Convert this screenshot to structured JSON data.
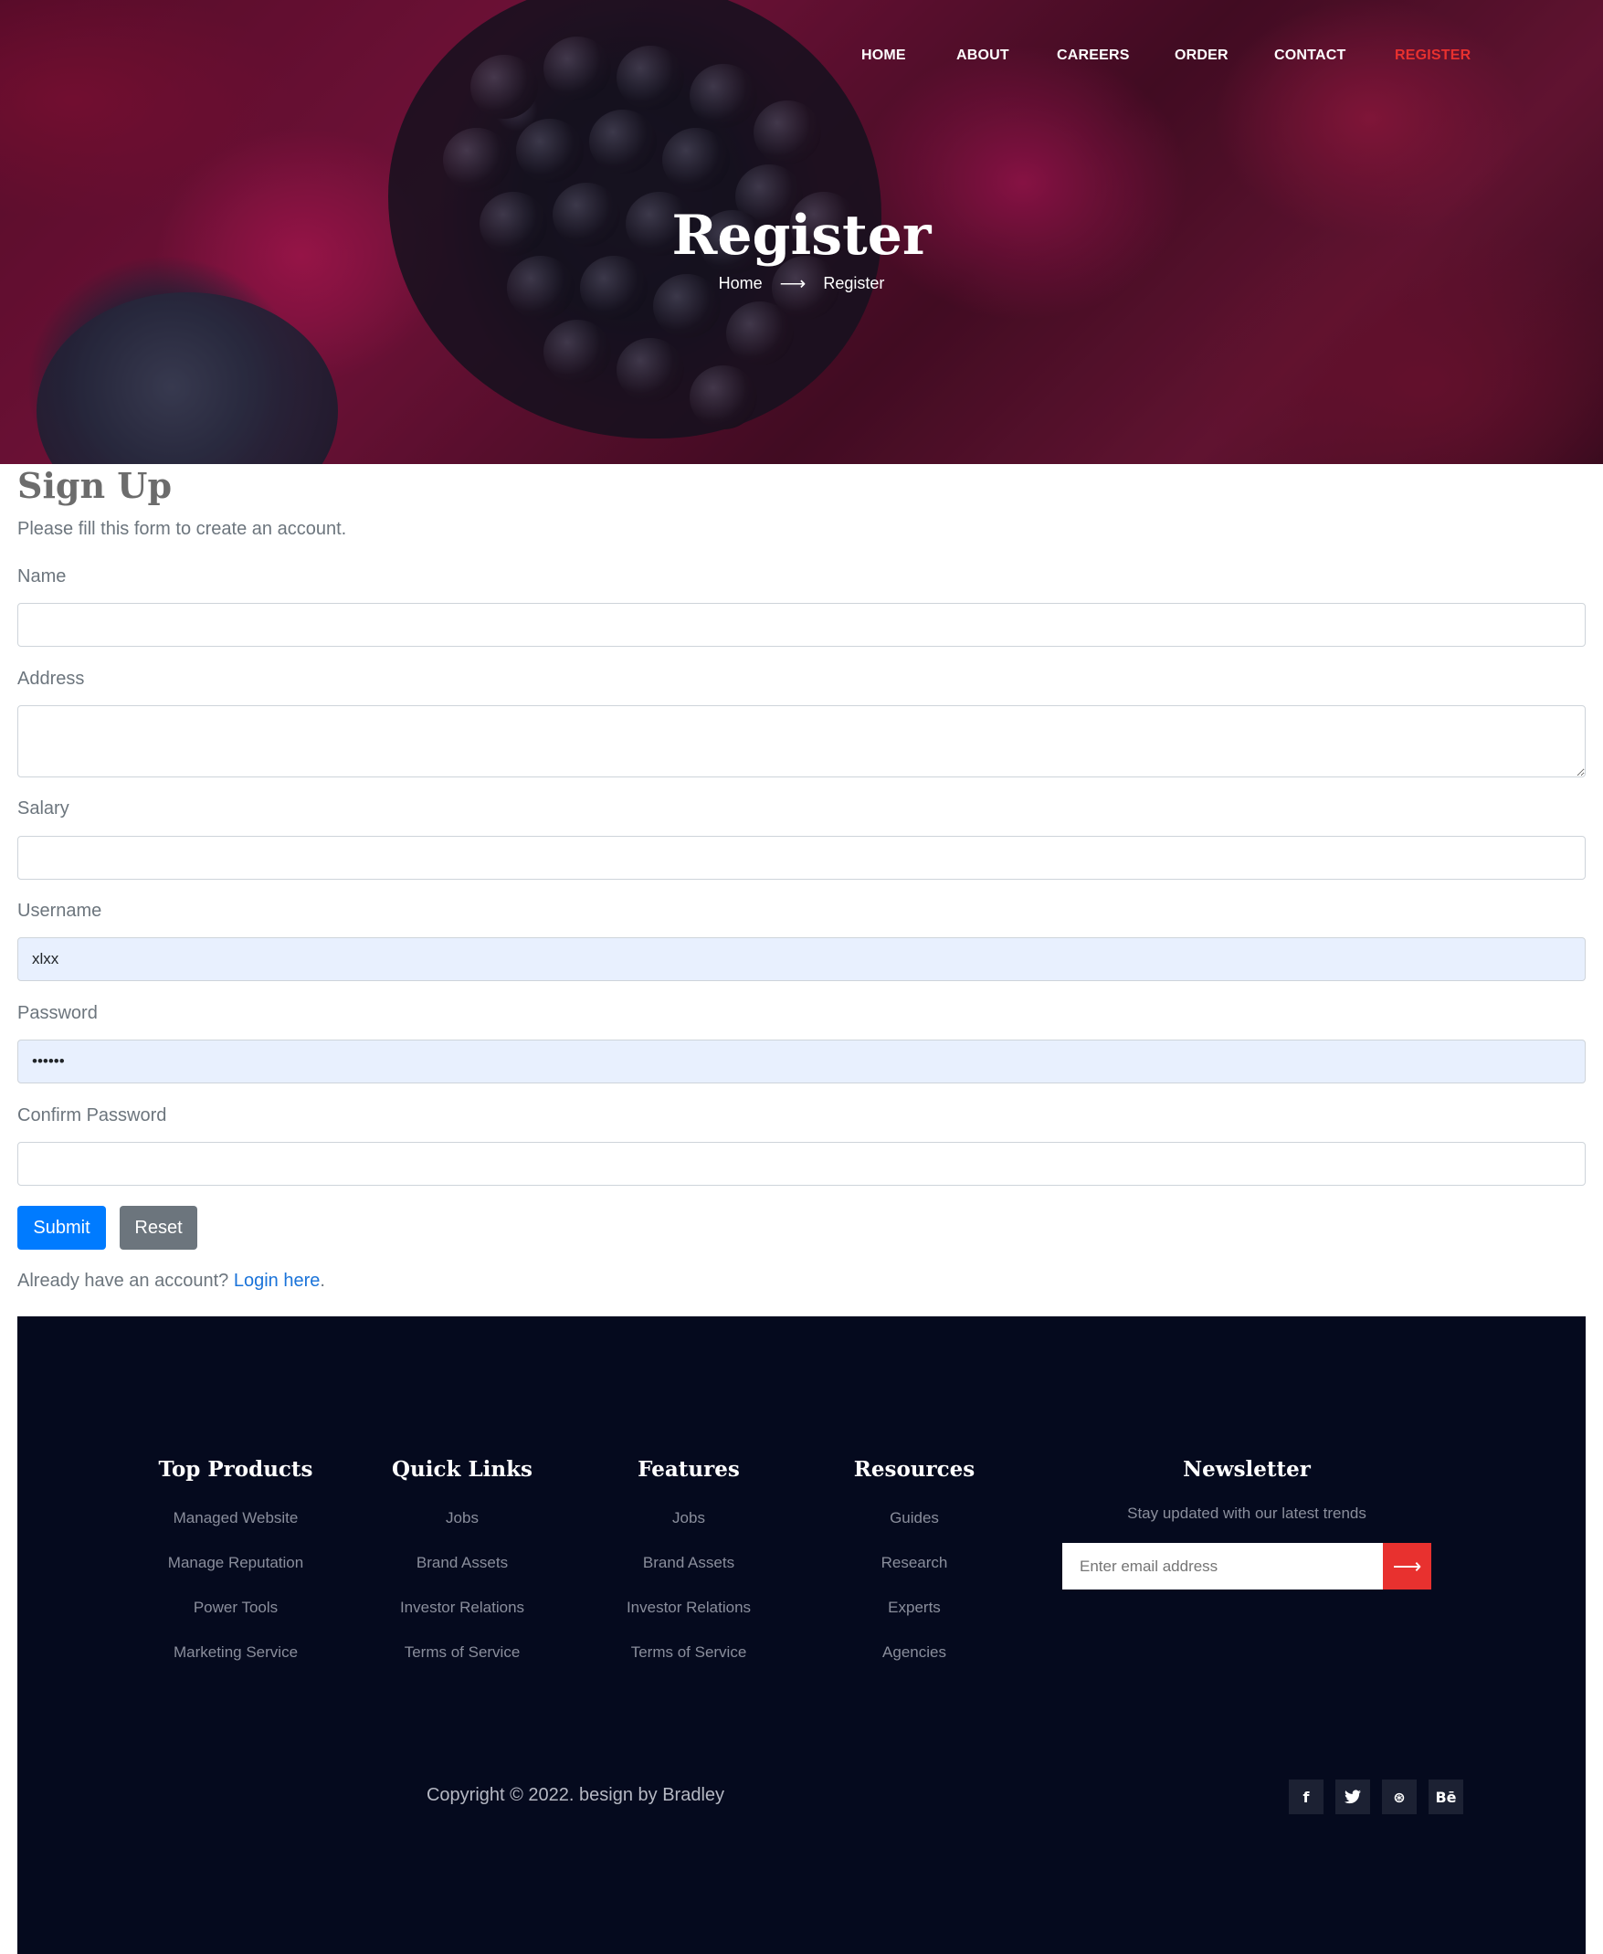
{
  "nav": {
    "items": [
      {
        "label": "HOME"
      },
      {
        "label": "ABOUT"
      },
      {
        "label": "CAREERS"
      },
      {
        "label": "ORDER"
      },
      {
        "label": "CONTACT"
      },
      {
        "label": "REGISTER"
      }
    ],
    "active_color": "#e8312f"
  },
  "hero": {
    "title": "Register",
    "breadcrumb": {
      "home": "Home",
      "current": "Register",
      "separator_icon": "arrow-right-icon"
    }
  },
  "form": {
    "title": "Sign Up",
    "subtitle": "Please fill this form to create an account.",
    "fields": {
      "name": {
        "label": "Name",
        "value": ""
      },
      "address": {
        "label": "Address",
        "value": ""
      },
      "salary": {
        "label": "Salary",
        "value": ""
      },
      "username": {
        "label": "Username",
        "value": "xlxx"
      },
      "password": {
        "label": "Password",
        "value": "••••••"
      },
      "confirm_password": {
        "label": "Confirm Password",
        "value": ""
      }
    },
    "submit_label": "Submit",
    "reset_label": "Reset",
    "login_prompt": "Already have an account?",
    "login_link": "Login here",
    "login_suffix": ".",
    "primary_color": "#007bff",
    "secondary_color": "#6c757d"
  },
  "footer": {
    "background": "#050a1e",
    "columns": [
      {
        "title": "Top Products",
        "items": [
          "Managed Website",
          "Manage Reputation",
          "Power Tools",
          "Marketing Service"
        ]
      },
      {
        "title": "Quick Links",
        "items": [
          "Jobs",
          "Brand Assets",
          "Investor Relations",
          "Terms of Service"
        ]
      },
      {
        "title": "Features",
        "items": [
          "Jobs",
          "Brand Assets",
          "Investor Relations",
          "Terms of Service"
        ]
      },
      {
        "title": "Resources",
        "items": [
          "Guides",
          "Research",
          "Experts",
          "Agencies"
        ]
      }
    ],
    "newsletter": {
      "title": "Newsletter",
      "text": "Stay updated with our latest trends",
      "placeholder": "Enter email address",
      "button_icon": "arrow-right-icon"
    },
    "copyright": "Copyright © 2022. besign by Bradley",
    "social": [
      {
        "icon": "facebook-icon",
        "glyph": "f"
      },
      {
        "icon": "twitter-icon",
        "glyph": "🐦"
      },
      {
        "icon": "dribbble-icon",
        "glyph": "⊛"
      },
      {
        "icon": "behance-icon",
        "glyph": "Bē"
      }
    ]
  }
}
